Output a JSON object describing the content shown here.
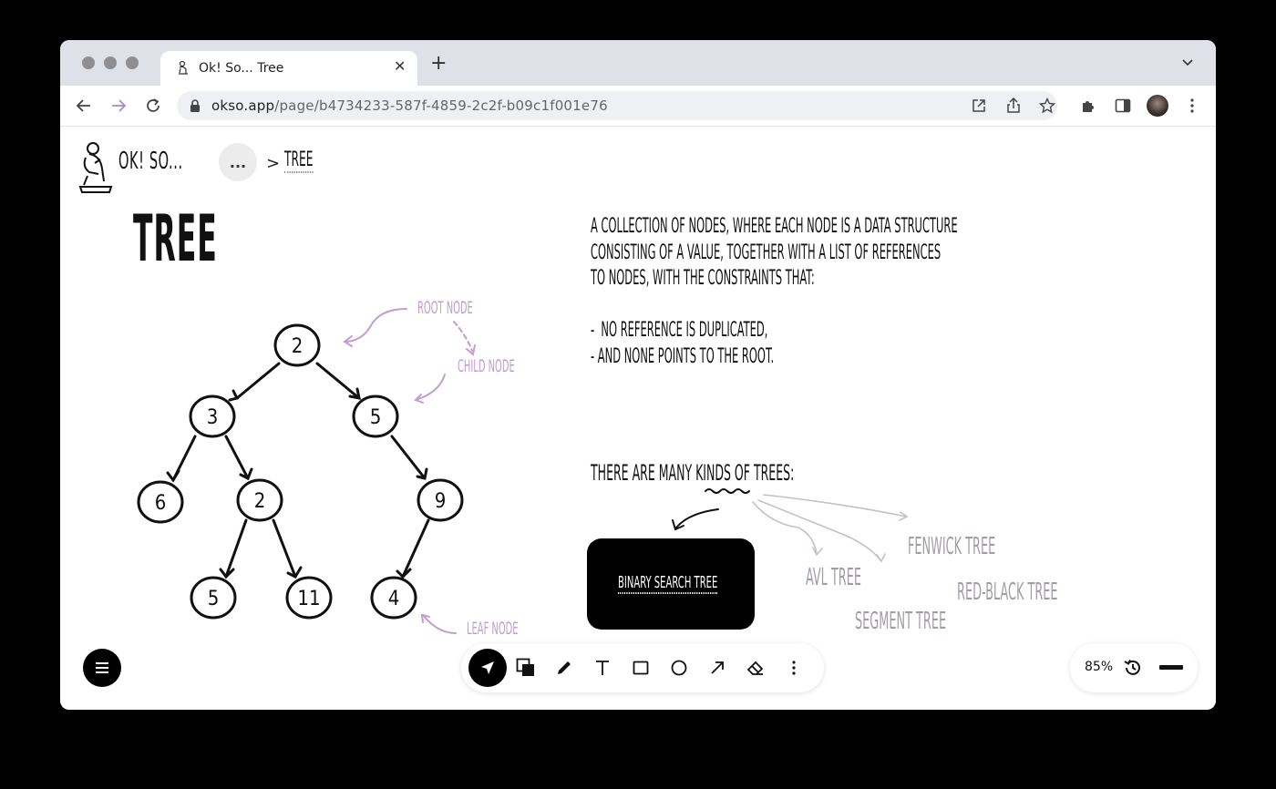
{
  "browser": {
    "tab_title": "Ok! So... Tree",
    "new_tab": "+",
    "url_host": "okso.app",
    "url_path": "/page/b4734233-587f-4859-2c2f-b09c1f001e76"
  },
  "header": {
    "brand": "OK! SO...",
    "more_button": "...",
    "breadcrumb_separator": ">",
    "breadcrumb_current": "TREE"
  },
  "canvas": {
    "title": "TREE",
    "description": "A COLLECTION OF NODES, WHERE EACH NODE IS A DATA STRUCTURE\nCONSISTING OF A VALUE, TOGETHER WITH A LIST OF REFERENCES\nTO NODES, WITH THE CONSTRAINTS THAT:\n\n-  NO REFERENCE IS DUPLICATED,\n- AND NONE POINTS TO THE ROOT.",
    "kinds_heading": "THERE ARE MANY KINDS OF TREES:",
    "bst_card": "BINARY SEARCH TREE",
    "tree_kinds": [
      "FENWICK TREE",
      "AVL TREE",
      "RED-BLACK TREE",
      "SEGMENT TREE"
    ],
    "annotations": {
      "root": "ROOT NODE",
      "child": "CHILD NODE",
      "leaf": "LEAF NODE"
    },
    "tree_nodes": [
      "2",
      "3",
      "5",
      "6",
      "2",
      "9",
      "5",
      "11",
      "4"
    ]
  },
  "toolbar": {
    "zoom": "85%"
  },
  "colors": {
    "annotation": "#c49bd0",
    "kind_label": "#a59ba6",
    "ink": "#111111"
  }
}
